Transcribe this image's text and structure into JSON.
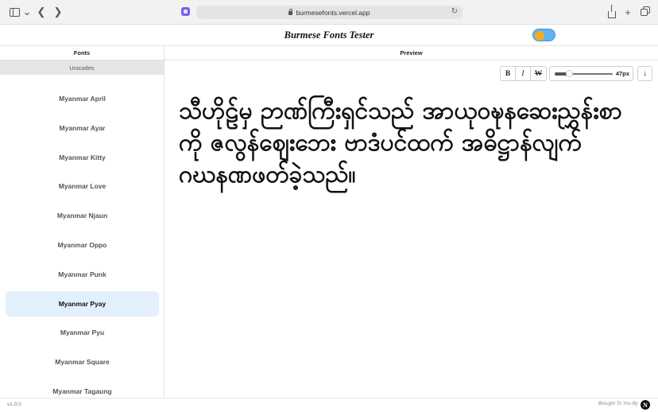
{
  "browser": {
    "url": "burmesefonts.vercel.app",
    "icons": [
      "sidebar-icon",
      "chevron-down-icon",
      "back-arrow-icon",
      "forward-arrow-icon",
      "lock-icon",
      "reload-icon",
      "share-icon",
      "plus-icon",
      "tabs-icon"
    ]
  },
  "header": {
    "title": "Burmese Fonts Tester",
    "theme_toggle_colors": {
      "track": "#62b4ef",
      "knob": "#f0ae1e"
    }
  },
  "fonts_panel": {
    "heading": "Fonts",
    "subtab": "Unicodes",
    "items": [
      {
        "label": "Myanmar April"
      },
      {
        "label": "Myanmar Ayar"
      },
      {
        "label": "Myanmar Kitty"
      },
      {
        "label": "Myanmar Love"
      },
      {
        "label": "Myanmar Njaun"
      },
      {
        "label": "Myanmar Oppo"
      },
      {
        "label": "Myanmar Punk"
      },
      {
        "label": "Myanmar Pyay"
      },
      {
        "label": "Myanmar Pyu"
      },
      {
        "label": "Myanmar Square"
      },
      {
        "label": "Myanmar Tagaung"
      }
    ],
    "selected": "Myanmar Pyay",
    "selected_color": "#e3f0fb"
  },
  "preview_panel": {
    "heading": "Preview",
    "toolbar": {
      "bold_label": "B",
      "italic_label": "I",
      "weight_label": "W",
      "font_size": "47px",
      "font_size_fraction": 0.25,
      "download_icon": "download-arrow-icon"
    },
    "text": "သီဟိုဠ်မှ ဉာဏ်ကြီးရှင်သည် အာယုဝဍ္ဎနဆေးညွှန်းစာကို ဇလွန်ဈေးဘေး ဗာဒံပင်ထက် အဓိဋ္ဌာန်လျက် ဂဃနဏဖတ်ခဲ့သည်။"
  },
  "footer": {
    "version": "v1.0.0",
    "credit": "Brought To You By",
    "logo_letter": "N"
  }
}
